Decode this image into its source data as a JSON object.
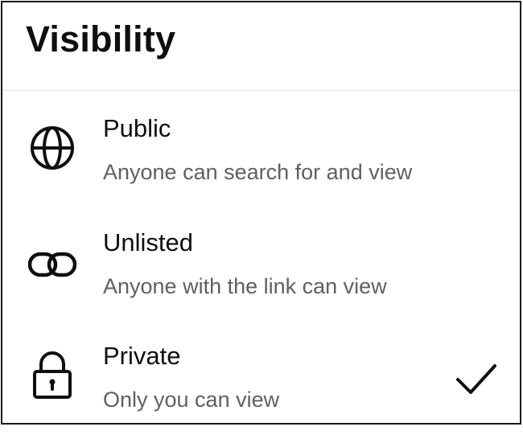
{
  "dialog": {
    "title": "Visibility",
    "options": [
      {
        "label": "Public",
        "description": "Anyone can search for and view",
        "icon": "globe-icon",
        "selected": false
      },
      {
        "label": "Unlisted",
        "description": "Anyone with the link can view",
        "icon": "link-icon",
        "selected": false
      },
      {
        "label": "Private",
        "description": "Only you can view",
        "icon": "lock-icon",
        "selected": true
      }
    ],
    "selected_icon": "checkmark-icon"
  }
}
